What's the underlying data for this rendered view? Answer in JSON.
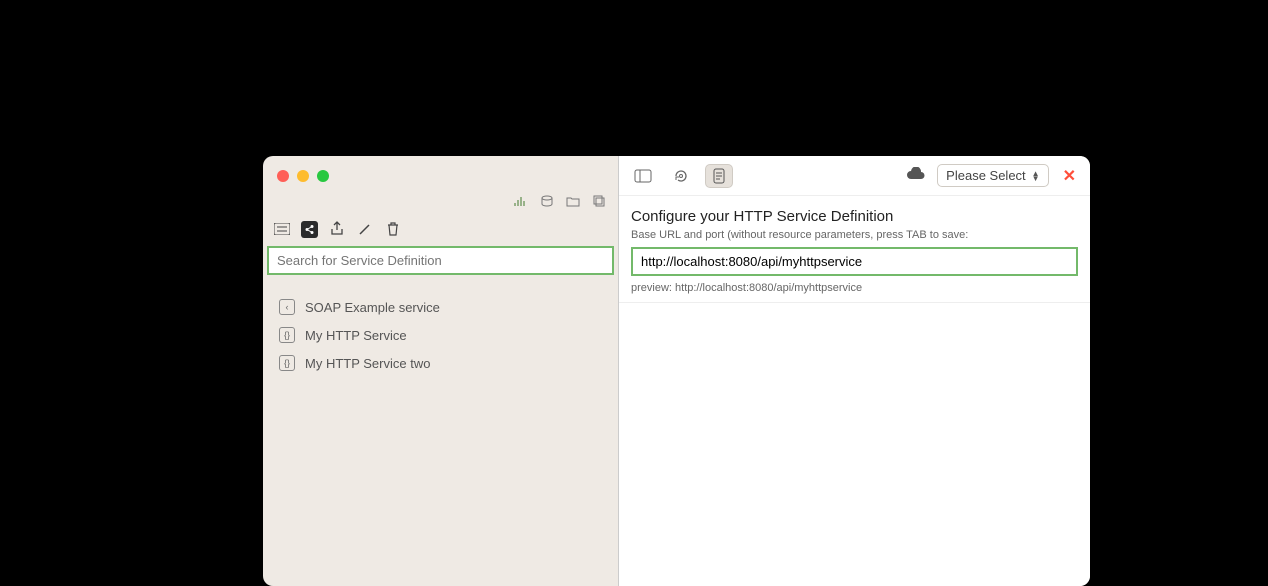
{
  "left": {
    "search_placeholder": "Search for Service Definition",
    "services": [
      {
        "icon": "‹",
        "label": "SOAP Example service"
      },
      {
        "icon": "{}",
        "label": "My HTTP Service"
      },
      {
        "icon": "{}",
        "label": "My HTTP Service two"
      }
    ]
  },
  "right": {
    "title": "Configure your HTTP Service Definition",
    "subtitle": "Base URL and port (without resource parameters, press TAB to save:",
    "url_value": "http://localhost:8080/api/myhttpservice",
    "preview_label": "preview: http://localhost:8080/api/myhttpservice",
    "select_label": "Please Select"
  }
}
